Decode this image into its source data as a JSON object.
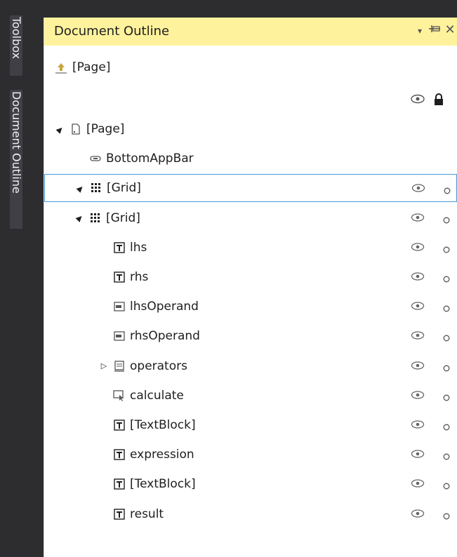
{
  "side_tabs": {
    "toolbox": "Toolbox",
    "document_outline": "Document Outline"
  },
  "panel": {
    "title": "Document Outline",
    "dropdown_glyph": "▾",
    "pin_glyph": "⊣",
    "close_glyph": "✕"
  },
  "breadcrumb": {
    "label": "[Page]",
    "icon": "navigate-up-icon"
  },
  "column_icons": [
    "eye-icon",
    "lock-icon"
  ],
  "tree": [
    {
      "label": "[Page]",
      "icon": "page-icon",
      "expander": "▲",
      "depth": 0,
      "eye": false,
      "lock": false
    },
    {
      "label": "BottomAppBar",
      "icon": "app-bar-icon",
      "expander": "",
      "depth": 1,
      "eye": false,
      "lock": false
    },
    {
      "label": "[Grid]",
      "icon": "grid-icon",
      "expander": "▲",
      "depth": 1,
      "eye": true,
      "lock": true,
      "selected": true
    },
    {
      "label": "[Grid]",
      "icon": "grid-icon",
      "expander": "▲",
      "depth": 2,
      "eye": true,
      "lock": true
    },
    {
      "label": "lhs",
      "icon": "textblock-icon",
      "expander": "",
      "depth": 3,
      "eye": true,
      "lock": true
    },
    {
      "label": "rhs",
      "icon": "textblock-icon",
      "expander": "",
      "depth": 3,
      "eye": true,
      "lock": true
    },
    {
      "label": "lhsOperand",
      "icon": "textbox-icon",
      "expander": "",
      "depth": 3,
      "eye": true,
      "lock": true
    },
    {
      "label": "rhsOperand",
      "icon": "textbox-icon",
      "expander": "",
      "depth": 3,
      "eye": true,
      "lock": true
    },
    {
      "label": "operators",
      "icon": "listbox-icon",
      "expander": "▷",
      "depth": 3,
      "eye": true,
      "lock": true
    },
    {
      "label": "calculate",
      "icon": "button-icon",
      "expander": "",
      "depth": 3,
      "eye": true,
      "lock": true
    },
    {
      "label": "[TextBlock]",
      "icon": "textblock-icon",
      "expander": "",
      "depth": 3,
      "eye": true,
      "lock": true
    },
    {
      "label": "expression",
      "icon": "textblock-icon",
      "expander": "",
      "depth": 3,
      "eye": true,
      "lock": true
    },
    {
      "label": "[TextBlock]",
      "icon": "textblock-icon",
      "expander": "",
      "depth": 3,
      "eye": true,
      "lock": true
    },
    {
      "label": "result",
      "icon": "textblock-icon",
      "expander": "",
      "depth": 3,
      "eye": true,
      "lock": true
    }
  ]
}
